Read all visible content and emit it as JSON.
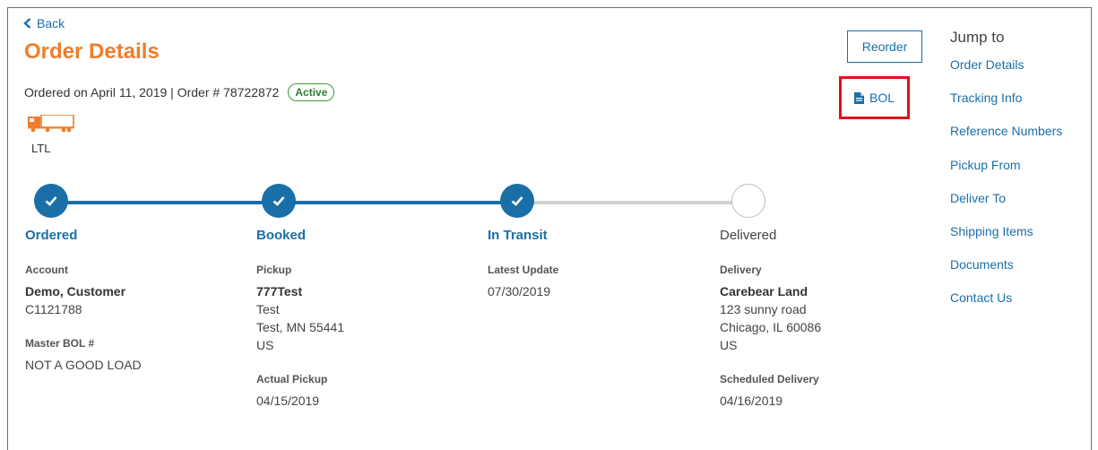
{
  "nav": {
    "back_label": "Back"
  },
  "page": {
    "title": "Order Details",
    "ordered_text": "Ordered on April 11, 2019 | Order # 78722872",
    "status_badge": "Active",
    "mode": "LTL",
    "truck_icon": "truck-icon"
  },
  "actions": {
    "reorder_label": "Reorder",
    "bol_label": "BOL",
    "bol_icon": "document-icon"
  },
  "jump_to": {
    "title": "Jump to",
    "links": [
      "Order Details",
      "Tracking Info",
      "Reference Numbers",
      "Pickup From",
      "Deliver To",
      "Shipping Items",
      "Documents",
      "Contact Us"
    ]
  },
  "progress": {
    "stages": [
      {
        "name": "Ordered",
        "complete": true
      },
      {
        "name": "Booked",
        "complete": true
      },
      {
        "name": "In Transit",
        "complete": true
      },
      {
        "name": "Delivered",
        "complete": false
      }
    ]
  },
  "ordered_col": {
    "account_label": "Account",
    "account_name": "Demo, Customer",
    "account_id": "C1121788",
    "master_bol_label": "Master BOL #",
    "master_bol": "NOT A GOOD LOAD"
  },
  "booked_col": {
    "pickup_label": "Pickup",
    "pickup_name": "777Test",
    "pickup_line1": "Test",
    "pickup_line2": "Test, MN 55441",
    "pickup_country": "US",
    "actual_pickup_label": "Actual Pickup",
    "actual_pickup": "04/15/2019"
  },
  "transit_col": {
    "latest_update_label": "Latest Update",
    "latest_update": "07/30/2019"
  },
  "delivered_col": {
    "delivery_label": "Delivery",
    "delivery_name": "Carebear Land",
    "delivery_line1": "123 sunny road",
    "delivery_line2": "Chicago, IL 60086",
    "delivery_country": "US",
    "scheduled_label": "Scheduled Delivery",
    "scheduled": "04/16/2019"
  },
  "colors": {
    "accent": "#1a6fa8",
    "title": "#ef7d2c",
    "highlight": "#e0101b",
    "badge": "#3c9a3c"
  }
}
